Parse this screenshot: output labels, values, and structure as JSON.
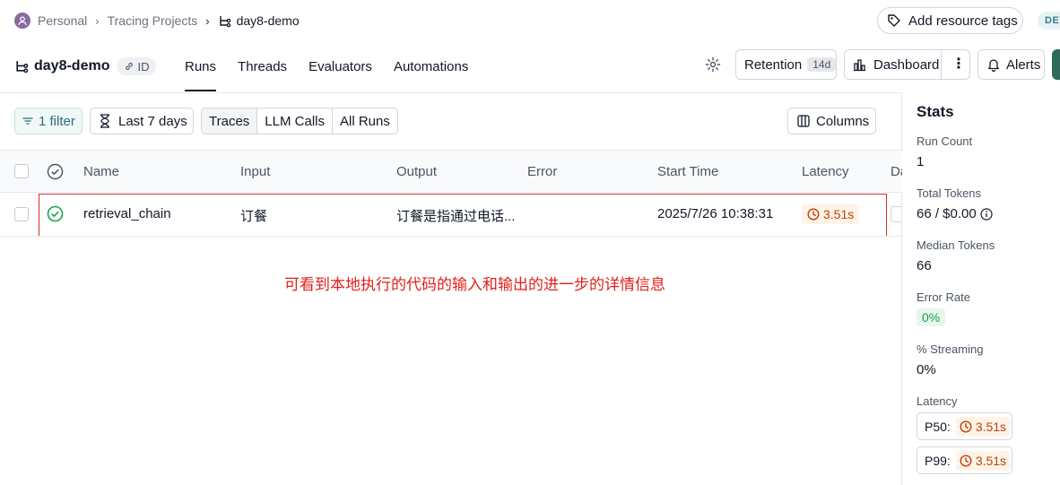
{
  "breadcrumb": {
    "workspace": "Personal",
    "section": "Tracing Projects",
    "project": "day8-demo"
  },
  "header": {
    "add_tags_label": "Add resource tags",
    "env_badge": "DEV"
  },
  "project": {
    "name": "day8-demo",
    "id_label": "ID"
  },
  "tabs": [
    {
      "label": "Runs",
      "active": true
    },
    {
      "label": "Threads"
    },
    {
      "label": "Evaluators"
    },
    {
      "label": "Automations"
    }
  ],
  "actions": {
    "retention_label": "Retention",
    "retention_value": "14d",
    "dashboard_label": "Dashboard",
    "alerts_label": "Alerts"
  },
  "toolbar": {
    "filter_label": "1 filter",
    "time_label": "Last 7 days",
    "segments": [
      "Traces",
      "LLM Calls",
      "All Runs"
    ],
    "selected_segment": "Traces",
    "columns_label": "Columns"
  },
  "table": {
    "headers": {
      "name": "Name",
      "input": "Input",
      "output": "Output",
      "error": "Error",
      "start_time": "Start Time",
      "latency": "Latency",
      "next_col": "Da"
    },
    "rows": [
      {
        "status": "success",
        "name": "retrieval_chain",
        "input": "订餐",
        "output": "订餐是指通过电话...",
        "error": "",
        "start_time": "2025/7/26 10:38:31",
        "latency": "3.51s"
      }
    ]
  },
  "annotation": "可看到本地执行的代码的输入和输出的进一步的详情信息",
  "stats": {
    "title": "Stats",
    "run_count_label": "Run Count",
    "run_count": "1",
    "total_tokens_label": "Total Tokens",
    "total_tokens": "66 / $0.00",
    "median_tokens_label": "Median Tokens",
    "median_tokens": "66",
    "error_rate_label": "Error Rate",
    "error_rate": "0%",
    "streaming_label": "% Streaming",
    "streaming": "0%",
    "latency_label": "Latency",
    "p50_label": "P50:",
    "p50": "3.51s",
    "p99_label": "P99:",
    "p99": "3.51s"
  },
  "colors": {
    "accent": "#2f6b5c",
    "highlight_border": "#d2322d",
    "annotation_text": "#e0201b",
    "latency_orange": "#c2410c",
    "success_green": "#16a34a"
  }
}
